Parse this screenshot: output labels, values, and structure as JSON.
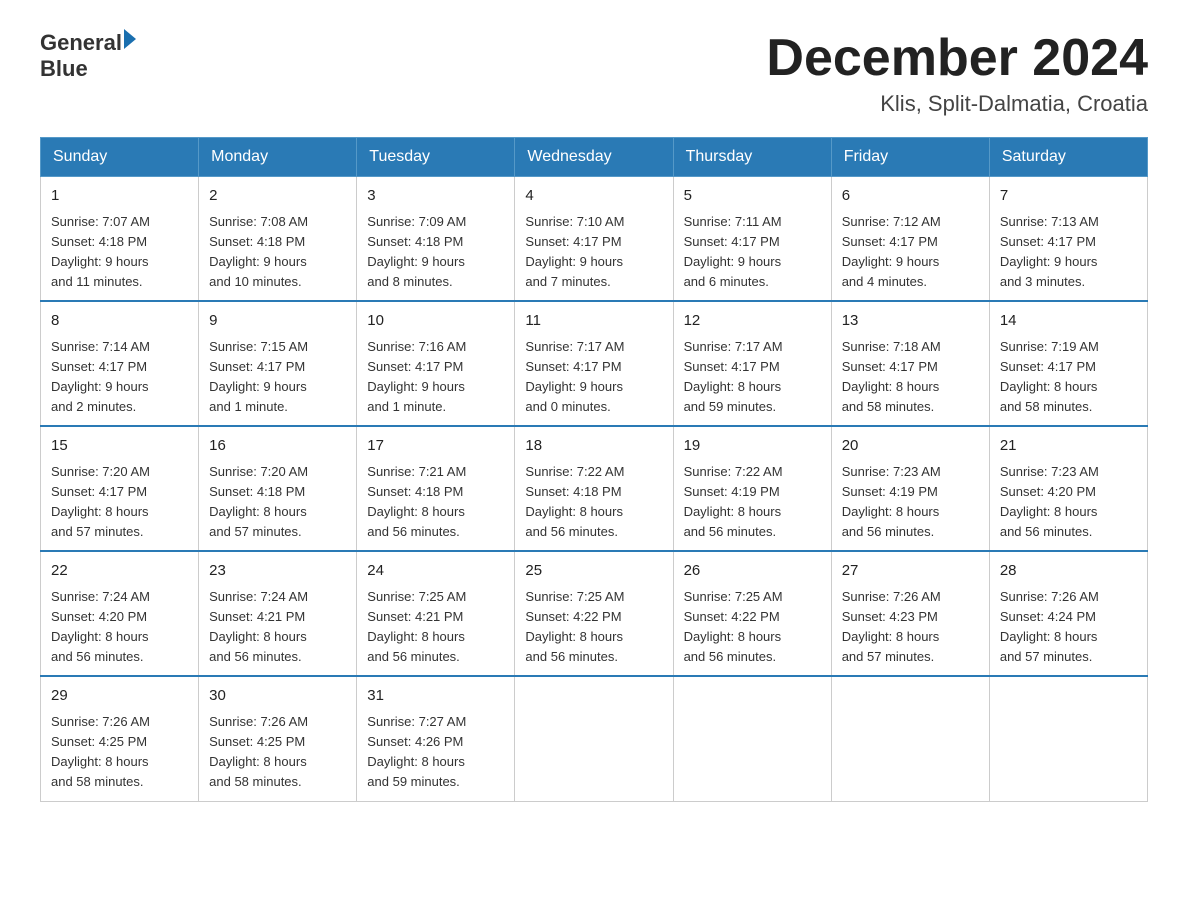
{
  "header": {
    "logo_line1": "General",
    "logo_line2": "Blue",
    "title": "December 2024",
    "subtitle": "Klis, Split-Dalmatia, Croatia"
  },
  "columns": [
    "Sunday",
    "Monday",
    "Tuesday",
    "Wednesday",
    "Thursday",
    "Friday",
    "Saturday"
  ],
  "weeks": [
    [
      {
        "day": "1",
        "info": "Sunrise: 7:07 AM\nSunset: 4:18 PM\nDaylight: 9 hours\nand 11 minutes."
      },
      {
        "day": "2",
        "info": "Sunrise: 7:08 AM\nSunset: 4:18 PM\nDaylight: 9 hours\nand 10 minutes."
      },
      {
        "day": "3",
        "info": "Sunrise: 7:09 AM\nSunset: 4:18 PM\nDaylight: 9 hours\nand 8 minutes."
      },
      {
        "day": "4",
        "info": "Sunrise: 7:10 AM\nSunset: 4:17 PM\nDaylight: 9 hours\nand 7 minutes."
      },
      {
        "day": "5",
        "info": "Sunrise: 7:11 AM\nSunset: 4:17 PM\nDaylight: 9 hours\nand 6 minutes."
      },
      {
        "day": "6",
        "info": "Sunrise: 7:12 AM\nSunset: 4:17 PM\nDaylight: 9 hours\nand 4 minutes."
      },
      {
        "day": "7",
        "info": "Sunrise: 7:13 AM\nSunset: 4:17 PM\nDaylight: 9 hours\nand 3 minutes."
      }
    ],
    [
      {
        "day": "8",
        "info": "Sunrise: 7:14 AM\nSunset: 4:17 PM\nDaylight: 9 hours\nand 2 minutes."
      },
      {
        "day": "9",
        "info": "Sunrise: 7:15 AM\nSunset: 4:17 PM\nDaylight: 9 hours\nand 1 minute."
      },
      {
        "day": "10",
        "info": "Sunrise: 7:16 AM\nSunset: 4:17 PM\nDaylight: 9 hours\nand 1 minute."
      },
      {
        "day": "11",
        "info": "Sunrise: 7:17 AM\nSunset: 4:17 PM\nDaylight: 9 hours\nand 0 minutes."
      },
      {
        "day": "12",
        "info": "Sunrise: 7:17 AM\nSunset: 4:17 PM\nDaylight: 8 hours\nand 59 minutes."
      },
      {
        "day": "13",
        "info": "Sunrise: 7:18 AM\nSunset: 4:17 PM\nDaylight: 8 hours\nand 58 minutes."
      },
      {
        "day": "14",
        "info": "Sunrise: 7:19 AM\nSunset: 4:17 PM\nDaylight: 8 hours\nand 58 minutes."
      }
    ],
    [
      {
        "day": "15",
        "info": "Sunrise: 7:20 AM\nSunset: 4:17 PM\nDaylight: 8 hours\nand 57 minutes."
      },
      {
        "day": "16",
        "info": "Sunrise: 7:20 AM\nSunset: 4:18 PM\nDaylight: 8 hours\nand 57 minutes."
      },
      {
        "day": "17",
        "info": "Sunrise: 7:21 AM\nSunset: 4:18 PM\nDaylight: 8 hours\nand 56 minutes."
      },
      {
        "day": "18",
        "info": "Sunrise: 7:22 AM\nSunset: 4:18 PM\nDaylight: 8 hours\nand 56 minutes."
      },
      {
        "day": "19",
        "info": "Sunrise: 7:22 AM\nSunset: 4:19 PM\nDaylight: 8 hours\nand 56 minutes."
      },
      {
        "day": "20",
        "info": "Sunrise: 7:23 AM\nSunset: 4:19 PM\nDaylight: 8 hours\nand 56 minutes."
      },
      {
        "day": "21",
        "info": "Sunrise: 7:23 AM\nSunset: 4:20 PM\nDaylight: 8 hours\nand 56 minutes."
      }
    ],
    [
      {
        "day": "22",
        "info": "Sunrise: 7:24 AM\nSunset: 4:20 PM\nDaylight: 8 hours\nand 56 minutes."
      },
      {
        "day": "23",
        "info": "Sunrise: 7:24 AM\nSunset: 4:21 PM\nDaylight: 8 hours\nand 56 minutes."
      },
      {
        "day": "24",
        "info": "Sunrise: 7:25 AM\nSunset: 4:21 PM\nDaylight: 8 hours\nand 56 minutes."
      },
      {
        "day": "25",
        "info": "Sunrise: 7:25 AM\nSunset: 4:22 PM\nDaylight: 8 hours\nand 56 minutes."
      },
      {
        "day": "26",
        "info": "Sunrise: 7:25 AM\nSunset: 4:22 PM\nDaylight: 8 hours\nand 56 minutes."
      },
      {
        "day": "27",
        "info": "Sunrise: 7:26 AM\nSunset: 4:23 PM\nDaylight: 8 hours\nand 57 minutes."
      },
      {
        "day": "28",
        "info": "Sunrise: 7:26 AM\nSunset: 4:24 PM\nDaylight: 8 hours\nand 57 minutes."
      }
    ],
    [
      {
        "day": "29",
        "info": "Sunrise: 7:26 AM\nSunset: 4:25 PM\nDaylight: 8 hours\nand 58 minutes."
      },
      {
        "day": "30",
        "info": "Sunrise: 7:26 AM\nSunset: 4:25 PM\nDaylight: 8 hours\nand 58 minutes."
      },
      {
        "day": "31",
        "info": "Sunrise: 7:27 AM\nSunset: 4:26 PM\nDaylight: 8 hours\nand 59 minutes."
      },
      {
        "day": "",
        "info": ""
      },
      {
        "day": "",
        "info": ""
      },
      {
        "day": "",
        "info": ""
      },
      {
        "day": "",
        "info": ""
      }
    ]
  ]
}
